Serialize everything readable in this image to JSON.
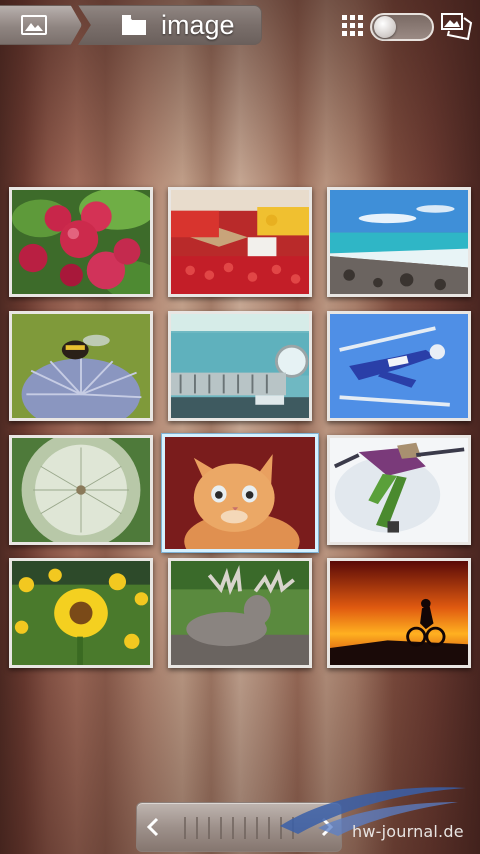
{
  "breadcrumb": {
    "home_icon": "image-icon",
    "folder_icon": "folder-icon",
    "current_folder": "image"
  },
  "toolbar": {
    "grid_icon": "grid-view-icon",
    "view_toggle": "off",
    "slideshow_icon": "slideshow-icon"
  },
  "gallery": {
    "columns": 3,
    "rows": 4,
    "selected_index": 7,
    "items": [
      {
        "subject": "apples"
      },
      {
        "subject": "market"
      },
      {
        "subject": "beach"
      },
      {
        "subject": "bumblebee"
      },
      {
        "subject": "vintage-car"
      },
      {
        "subject": "ski-jumper"
      },
      {
        "subject": "dandelion"
      },
      {
        "subject": "kitten"
      },
      {
        "subject": "snow-angel"
      },
      {
        "subject": "sunflowers"
      },
      {
        "subject": "moose"
      },
      {
        "subject": "sunset-cyclist"
      }
    ]
  },
  "scrubber": {
    "left_icon": "chevron-left-icon",
    "right_icon": "chevron-right-icon"
  },
  "watermark": "hw-journal.de",
  "colors": {
    "selection_border": "#d6f1ff",
    "thumb_border": "#e9e6e3"
  }
}
